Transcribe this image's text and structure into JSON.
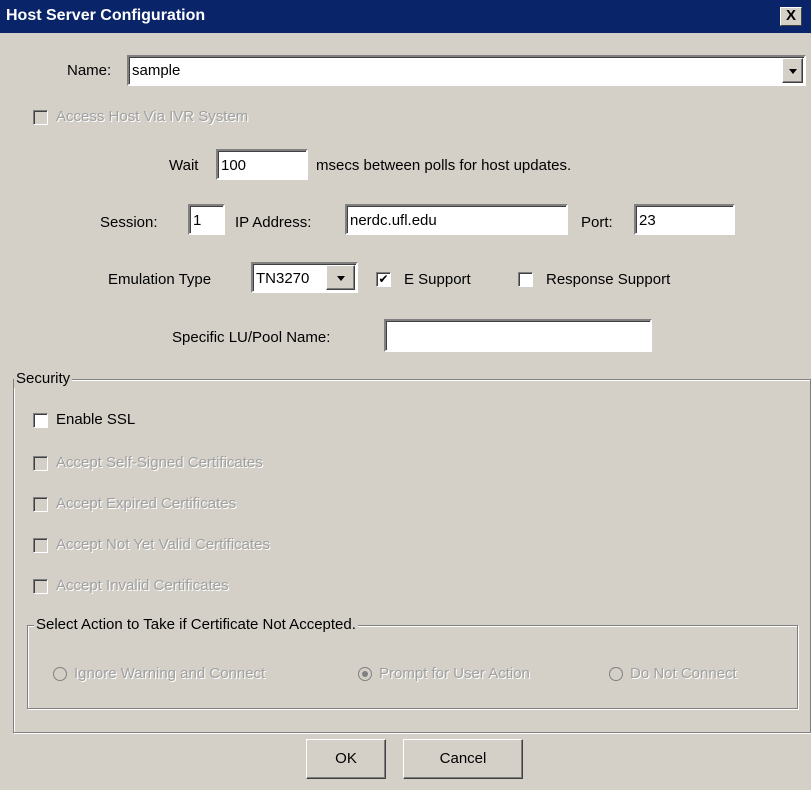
{
  "window": {
    "title": "Host Server Configuration",
    "close_glyph": "X"
  },
  "name": {
    "label": "Name:",
    "value": "sample"
  },
  "ivr": {
    "label": "Access Host Via IVR System",
    "checked": false,
    "enabled": false
  },
  "wait": {
    "label": "Wait",
    "value": "100",
    "suffix": "msecs between polls for host updates."
  },
  "session": {
    "label": "Session:",
    "value": "1"
  },
  "ip": {
    "label": "IP Address:",
    "value": "nerdc.ufl.edu"
  },
  "port": {
    "label": "Port:",
    "value": "23"
  },
  "emulation": {
    "label": "Emulation Type",
    "value": "TN3270"
  },
  "e_support": {
    "label": "E Support",
    "checked": true
  },
  "response_support": {
    "label": "Response Support",
    "checked": false
  },
  "lu": {
    "label": "Specific LU/Pool Name:",
    "value": ""
  },
  "security": {
    "title": "Security",
    "enable_ssl": {
      "label": "Enable SSL",
      "checked": false
    },
    "cert_options": [
      "Accept Self-Signed Certificates",
      "Accept Expired Certificates",
      "Accept Not Yet Valid Certificates",
      "Accept Invalid Certificates"
    ],
    "action_group": {
      "title": "Select Action to Take if Certificate Not Accepted.",
      "options": [
        "Ignore Warning and Connect",
        "Prompt for User Action",
        "Do Not Connect"
      ],
      "selected": "Prompt for User Action"
    }
  },
  "buttons": {
    "ok": "OK",
    "cancel": "Cancel"
  },
  "colors": {
    "titlebar": "#0a246a",
    "window_bg": "#d4d0c8",
    "disabled_text": "#a0a0a0"
  }
}
